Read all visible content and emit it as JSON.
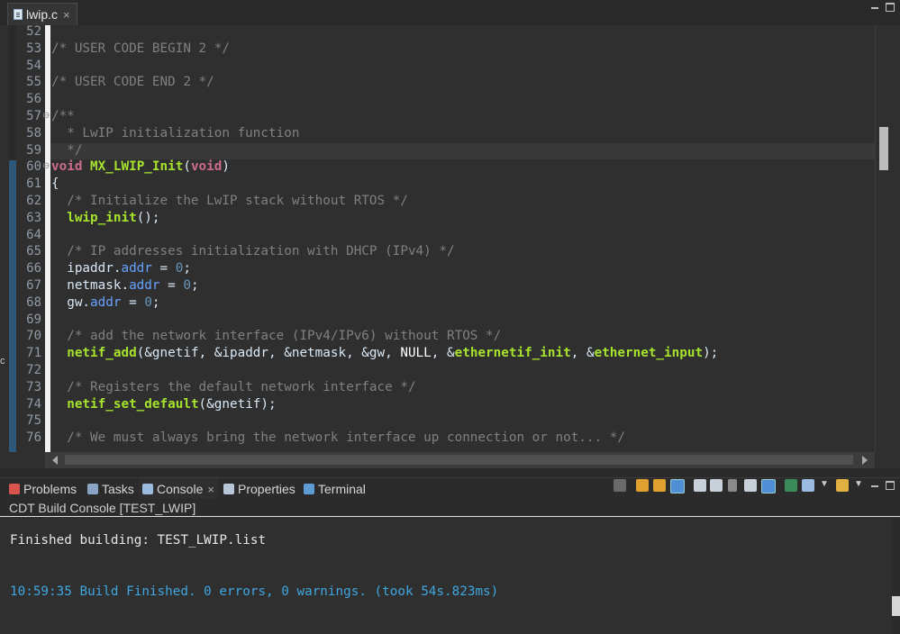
{
  "editor_tab": {
    "label": "lwip.c",
    "close": "×"
  },
  "code": {
    "lines": [
      {
        "n": "52",
        "t": []
      },
      {
        "n": "53",
        "t": [
          {
            "c": "cm",
            "v": "/* USER CODE BEGIN 2 */"
          }
        ]
      },
      {
        "n": "54",
        "t": []
      },
      {
        "n": "55",
        "t": [
          {
            "c": "cm",
            "v": "/* USER CODE END 2 */"
          }
        ]
      },
      {
        "n": "56",
        "t": []
      },
      {
        "n": "57",
        "fold": "⊖",
        "t": [
          {
            "c": "cm",
            "v": "/**"
          }
        ]
      },
      {
        "n": "58",
        "t": [
          {
            "c": "cm",
            "v": "  * LwIP initialization function"
          }
        ]
      },
      {
        "n": "59",
        "t": [
          {
            "c": "cm",
            "v": "  */"
          }
        ]
      },
      {
        "n": "60",
        "fold": "⊖",
        "t": [
          {
            "c": "kw",
            "v": "void"
          },
          {
            "c": "",
            "v": " "
          },
          {
            "c": "fn",
            "v": "MX_LWIP_Init"
          },
          {
            "c": "",
            "v": "("
          },
          {
            "c": "kw",
            "v": "void"
          },
          {
            "c": "",
            "v": ")"
          }
        ]
      },
      {
        "n": "61",
        "t": [
          {
            "c": "",
            "v": "{"
          }
        ]
      },
      {
        "n": "62",
        "t": [
          {
            "c": "cm",
            "v": "  /* Initialize the LwIP stack without RTOS */"
          }
        ]
      },
      {
        "n": "63",
        "t": [
          {
            "c": "",
            "v": "  "
          },
          {
            "c": "fn",
            "v": "lwip_init"
          },
          {
            "c": "",
            "v": "();"
          }
        ]
      },
      {
        "n": "64",
        "t": []
      },
      {
        "n": "65",
        "t": [
          {
            "c": "cm",
            "v": "  /* IP addresses initialization with DHCP (IPv4) */"
          }
        ]
      },
      {
        "n": "66",
        "t": [
          {
            "c": "",
            "v": "  ipaddr."
          },
          {
            "c": "fld",
            "v": "addr"
          },
          {
            "c": "",
            "v": " = "
          },
          {
            "c": "num",
            "v": "0"
          },
          {
            "c": "",
            "v": ";"
          }
        ]
      },
      {
        "n": "67",
        "t": [
          {
            "c": "",
            "v": "  netmask."
          },
          {
            "c": "fld",
            "v": "addr"
          },
          {
            "c": "",
            "v": " = "
          },
          {
            "c": "num",
            "v": "0"
          },
          {
            "c": "",
            "v": ";"
          }
        ]
      },
      {
        "n": "68",
        "t": [
          {
            "c": "",
            "v": "  gw."
          },
          {
            "c": "fld",
            "v": "addr"
          },
          {
            "c": "",
            "v": " = "
          },
          {
            "c": "num",
            "v": "0"
          },
          {
            "c": "",
            "v": ";"
          }
        ]
      },
      {
        "n": "69",
        "t": []
      },
      {
        "n": "70",
        "t": [
          {
            "c": "cm",
            "v": "  /* add the network interface (IPv4/IPv6) without RTOS */"
          }
        ]
      },
      {
        "n": "71",
        "t": [
          {
            "c": "",
            "v": "  "
          },
          {
            "c": "fn",
            "v": "netif_add"
          },
          {
            "c": "",
            "v": "(&gnetif, &ipaddr, &netmask, &gw, "
          },
          {
            "c": "nul",
            "v": "NULL"
          },
          {
            "c": "",
            "v": ", &"
          },
          {
            "c": "fn",
            "v": "ethernetif_init"
          },
          {
            "c": "",
            "v": ", &"
          },
          {
            "c": "fn",
            "v": "ethernet_input"
          },
          {
            "c": "",
            "v": ");"
          }
        ]
      },
      {
        "n": "72",
        "t": []
      },
      {
        "n": "73",
        "t": [
          {
            "c": "cm",
            "v": "  /* Registers the default network interface */"
          }
        ]
      },
      {
        "n": "74",
        "t": [
          {
            "c": "",
            "v": "  "
          },
          {
            "c": "fn",
            "v": "netif_set_default"
          },
          {
            "c": "",
            "v": "(&gnetif);"
          }
        ]
      },
      {
        "n": "75",
        "t": []
      },
      {
        "n": "76",
        "t": [
          {
            "c": "cm",
            "v": "  /* We must always bring the network interface up connection or not... */"
          }
        ]
      }
    ]
  },
  "panel_tabs": [
    {
      "label": "Problems",
      "icon": "problems-icon",
      "color": "#d9534f"
    },
    {
      "label": "Tasks",
      "icon": "tasks-icon",
      "color": "#8aa4c4"
    },
    {
      "label": "Console",
      "icon": "console-icon",
      "color": "#9bbbe0",
      "active": true,
      "close": "×"
    },
    {
      "label": "Properties",
      "icon": "properties-icon",
      "color": "#b9c7d9"
    },
    {
      "label": "Terminal",
      "icon": "terminal-icon",
      "color": "#5c9bd6"
    }
  ],
  "console": {
    "title": "CDT Build Console [TEST_LWIP]",
    "line1": "Finished building: TEST_LWIP.list",
    "line2": "10:59:35 Build Finished. 0 errors, 0 warnings. (took 54s.823ms)",
    "line1_color": "#e6e6e6",
    "line2_color": "#3fa7e0"
  },
  "left_marker": "c"
}
